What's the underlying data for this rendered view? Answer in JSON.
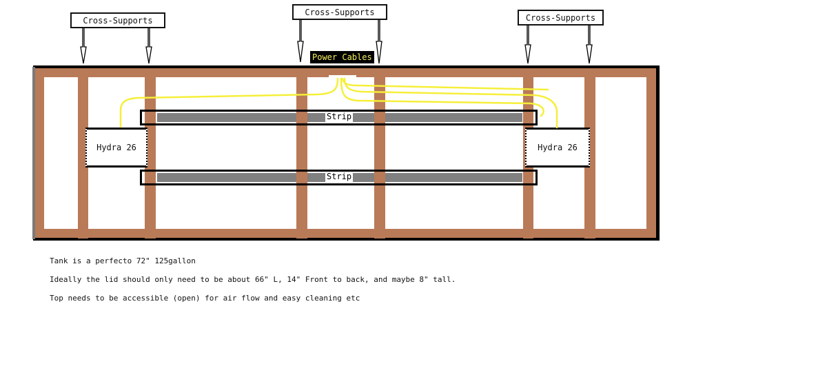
{
  "diagram": {
    "callouts": [
      {
        "id": "left",
        "label": "Cross-Supports"
      },
      {
        "id": "center",
        "label": "Cross-Supports"
      },
      {
        "id": "right",
        "label": "Cross-Supports"
      }
    ],
    "power_cables_label": "Power Cables",
    "strips": [
      {
        "label": "Strip"
      },
      {
        "label": "Strip"
      }
    ],
    "lights": [
      {
        "label": "Hydra 26"
      },
      {
        "label": "Hydra 26"
      }
    ],
    "colors": {
      "wood": "#b97a57",
      "frame_edge": "#000000",
      "strip_fill": "#808080",
      "cable": "#f5ef3a",
      "power_label_text": "#f5ef5a"
    }
  },
  "notes": [
    "Tank is a perfecto 72\" 125gallon",
    "Ideally the lid should only need to be about 66\" L, 14\" Front to back, and maybe 8\" tall.",
    "Top needs to be accessible (open) for air flow and easy cleaning etc"
  ]
}
